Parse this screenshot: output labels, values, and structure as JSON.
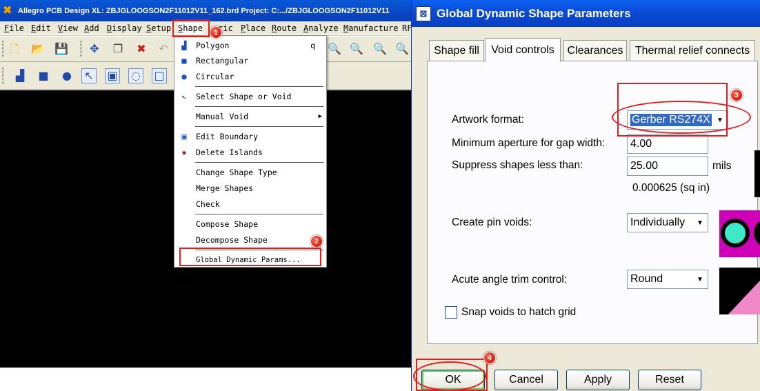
{
  "allegro": {
    "title": "Allegro PCB Design XL: ZBJGLOOGSON2F11012V11_162.brd  Project: C:.../ZBJGLOOGSON2F11012V11",
    "menus": [
      {
        "label": "File",
        "key": "F"
      },
      {
        "label": "Edit",
        "key": "E"
      },
      {
        "label": "View",
        "key": "V"
      },
      {
        "label": "Add",
        "key": "A"
      },
      {
        "label": "Display",
        "key": "D"
      },
      {
        "label": "Setup",
        "key": "S"
      },
      {
        "label": "Shape",
        "key": "S"
      },
      {
        "label": "ric",
        "key": ""
      },
      {
        "label": "Place",
        "key": "P"
      },
      {
        "label": "Route",
        "key": "R"
      },
      {
        "label": "Analyze",
        "key": "A"
      },
      {
        "label": "Manufacture",
        "key": "M"
      },
      {
        "label": "RF",
        "key": ""
      }
    ],
    "toolbar1_icons": [
      "new-file-icon",
      "open-folder-icon",
      "save-icon",
      "move-icon",
      "copy-icon",
      "delete-icon",
      "undo-icon",
      "zoom-fit-icon",
      "zoom-in-icon",
      "zoom-out-icon",
      "zoom-previous-icon"
    ],
    "toolbar2_icons": [
      "shape-polygon-icon",
      "shape-rectangle-icon",
      "shape-circle-icon",
      "select-shape-icon",
      "edit-boundary-icon",
      "void-circle-icon",
      "void-rectangle-icon"
    ],
    "shape_menu": {
      "items": [
        {
          "label": "Polygon",
          "shortcut": "q",
          "icon": "polygon-icon"
        },
        {
          "label": "Rectangular",
          "shortcut": "",
          "icon": "rectangle-icon"
        },
        {
          "label": "Circular",
          "shortcut": "",
          "icon": "circle-icon"
        },
        {
          "label": "Select Shape or Void",
          "shortcut": "",
          "icon": "select-icon"
        },
        {
          "label": "Manual Void",
          "shortcut": "",
          "icon": "",
          "submenu": true
        },
        {
          "label": "Edit Boundary",
          "shortcut": "",
          "icon": "boundary-icon"
        },
        {
          "label": "Delete Islands",
          "shortcut": "",
          "icon": "islands-icon"
        },
        {
          "label": "Change Shape Type",
          "shortcut": "",
          "icon": ""
        },
        {
          "label": "Merge Shapes",
          "shortcut": "",
          "icon": ""
        },
        {
          "label": "Check",
          "shortcut": "",
          "icon": ""
        },
        {
          "label": "Compose Shape",
          "shortcut": "",
          "icon": ""
        },
        {
          "label": "Decompose Shape",
          "shortcut": "",
          "icon": ""
        },
        {
          "label": "Global Dynamic Params...",
          "shortcut": "",
          "icon": ""
        }
      ]
    }
  },
  "annotations": {
    "b1": "1",
    "b2": "2",
    "b3": "3",
    "b4": "4"
  },
  "dialog": {
    "title": "Global Dynamic Shape Parameters",
    "tabs": [
      "Shape fill",
      "Void controls",
      "Clearances",
      "Thermal relief connects"
    ],
    "active_tab": "Void controls",
    "artwork_format_label": "Artwork format:",
    "artwork_format_value": "Gerber RS274X",
    "min_aperture_label": "Minimum aperture for gap width:",
    "min_aperture_value": "4.00",
    "suppress_label": "Suppress shapes less than:",
    "suppress_value": "25.00",
    "suppress_unit": "mils",
    "suppress_sqin": "0.000625 (sq in)",
    "pin_voids_label": "Create pin voids:",
    "pin_voids_value": "Individually",
    "acute_label": "Acute angle trim control:",
    "acute_value": "Round",
    "snap_label": "Snap voids to hatch grid",
    "snap_checked": false,
    "buttons": {
      "ok": "OK",
      "cancel": "Cancel",
      "apply": "Apply",
      "reset": "Reset"
    }
  },
  "colors": {
    "annotation_red": "#e21d1d",
    "pad_cyan": "#3fe8c8",
    "pad_magenta": "#d000b8",
    "shape_pink": "#f088c8"
  }
}
